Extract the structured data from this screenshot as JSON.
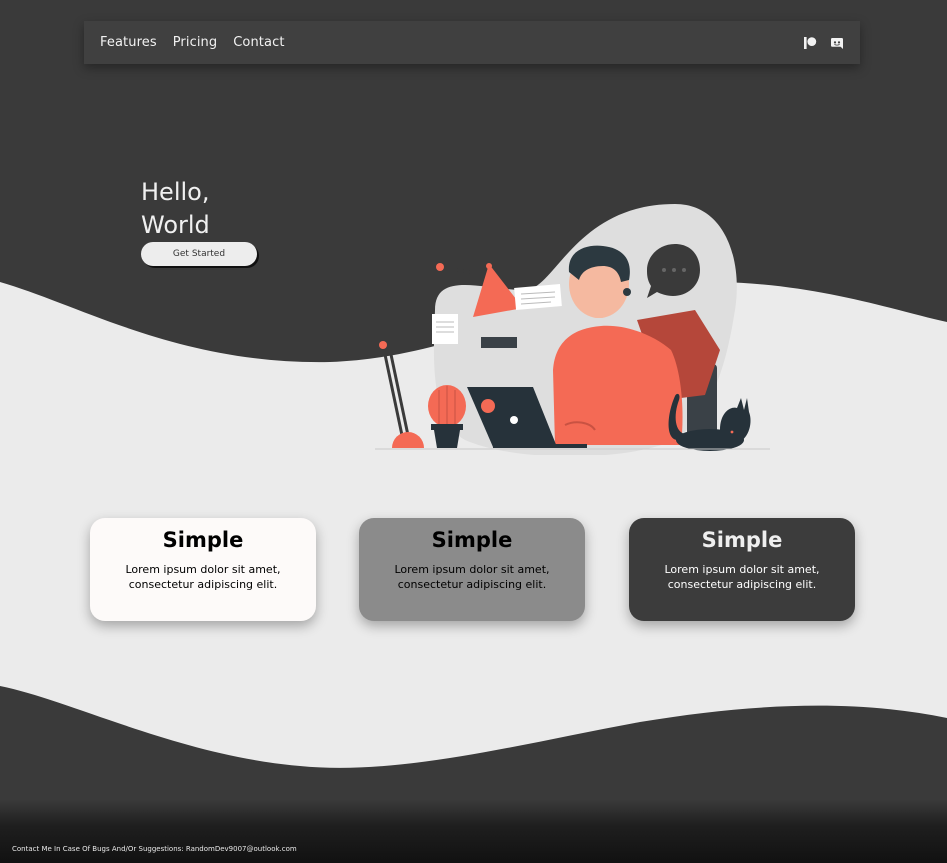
{
  "nav": {
    "links": [
      "Features",
      "Pricing",
      "Contact"
    ],
    "icons": [
      "patreon-icon",
      "discord-icon"
    ]
  },
  "hero": {
    "title_line1": "Hello,",
    "title_line2": "World",
    "cta_label": "Get Started"
  },
  "cards": [
    {
      "title": "Simple",
      "text": "Lorem ipsum dolor sit amet, consectetur adipiscing elit."
    },
    {
      "title": "Simple",
      "text": "Lorem ipsum dolor sit amet, consectetur adipiscing elit."
    },
    {
      "title": "Simple",
      "text": "Lorem ipsum dolor sit amet, consectetur adipiscing elit."
    }
  ],
  "footer": {
    "text": "Contact Me In Case Of Bugs And/Or Suggestions: RandomDev9007@outlook.com"
  },
  "colors": {
    "background_dark": "#3a3a3a",
    "wave_light": "#ebebeb",
    "accent": "#f46a55",
    "card_light": "#fdfaf9",
    "card_mid": "#8b8b8b",
    "card_dark": "#3c3c3c"
  }
}
